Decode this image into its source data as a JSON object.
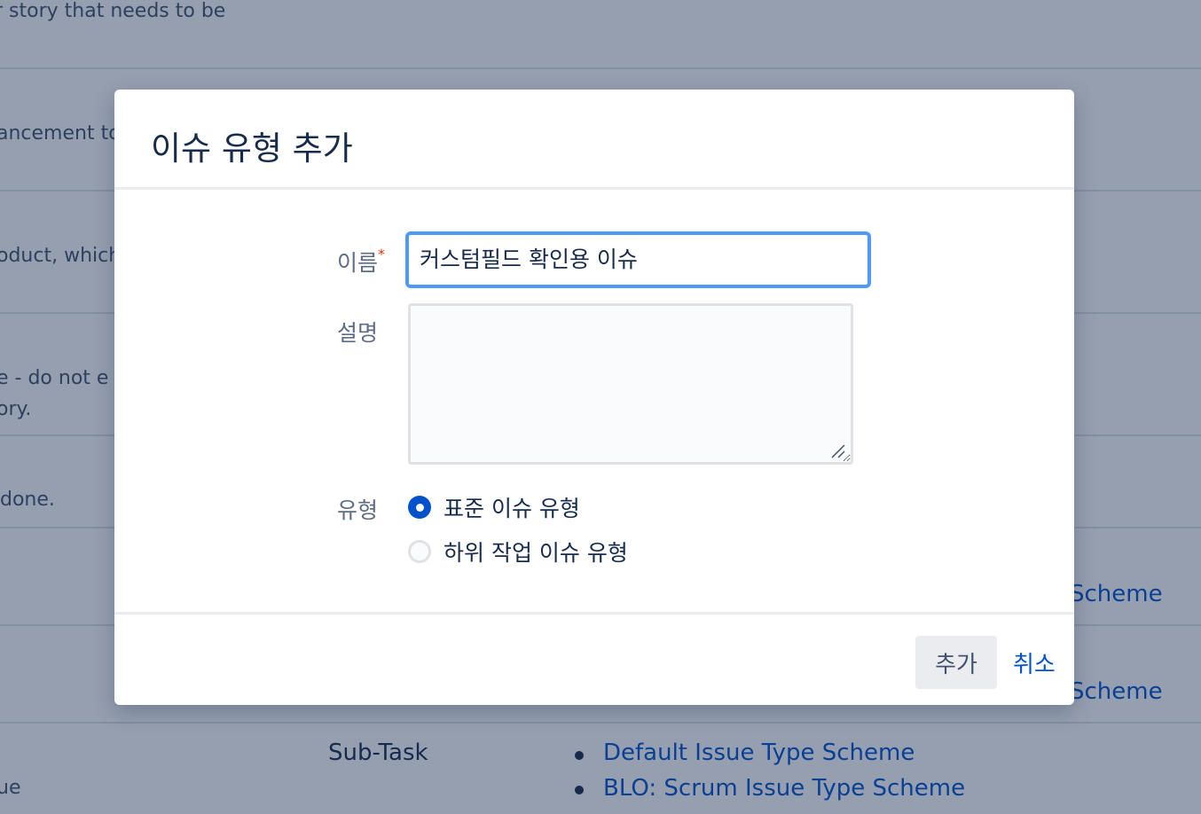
{
  "background": {
    "description_fragments": [
      "r story that needs to be",
      "ancement to",
      "oduct, which",
      "e - do not e",
      "ory.",
      "done.",
      "ue"
    ],
    "subtask_row": {
      "issue_type": "Sub-Task",
      "schemes": [
        "Default Issue Type Scheme",
        "BLO: Scrum Issue Type Scheme"
      ]
    },
    "scheme_fragments": [
      "Scheme",
      "Scheme"
    ]
  },
  "dialog": {
    "title": "이슈 유형 추가",
    "fields": {
      "name": {
        "label": "이름",
        "required_marker": "*",
        "value": "커스텀필드 확인용 이슈"
      },
      "description": {
        "label": "설명",
        "value": ""
      },
      "type": {
        "label": "유형",
        "options": [
          {
            "label": "표준 이슈 유형",
            "selected": true
          },
          {
            "label": "하위 작업 이슈 유형",
            "selected": false
          }
        ]
      }
    },
    "footer": {
      "add_label": "추가",
      "cancel_label": "취소"
    }
  }
}
